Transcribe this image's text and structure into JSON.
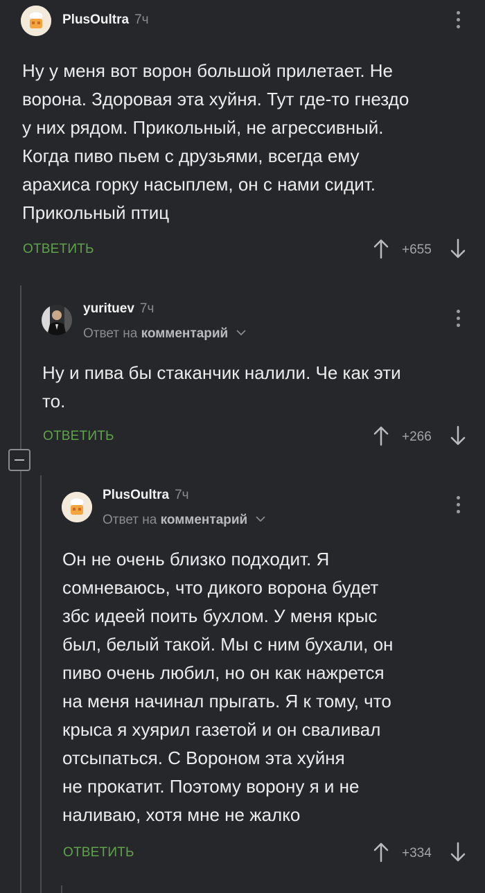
{
  "comments": [
    {
      "author": "PlusOultra",
      "time": "7ч",
      "text_lines": [
        "Ну у меня вот ворон большой прилетает. Не",
        "ворона. Здоровая эта хуйня. Тут где-то гнездо",
        "у них рядом. Прикольный, не агрессивный.",
        "Когда пиво пьем с друзьями, всегда ему",
        "арахиса горку насыплем, он с нами сидит.",
        "Прикольный птиц"
      ],
      "reply_label": "ОТВЕТИТЬ",
      "rating": "+655"
    },
    {
      "author": "yurituev",
      "time": "7ч",
      "reply_to_prefix": "Ответ на",
      "reply_to_target": "комментарий",
      "text_lines": [
        "Ну и пива бы стаканчик налили. Че как эти",
        "то."
      ],
      "reply_label": "ОТВЕТИТЬ",
      "rating": "+266"
    },
    {
      "author": "PlusOultra",
      "time": "7ч",
      "reply_to_prefix": "Ответ на",
      "reply_to_target": "комментарий",
      "text_lines": [
        "Он не очень близко подходит. Я",
        "сомневаюсь, что дикого ворона будет",
        "збс идеей поить бухлом. У меня крыс",
        "был, белый такой. Мы с ним бухали, он",
        "пиво очень любил, но он как нажрется",
        "на меня начинал прыгать. Я к тому, что",
        "крыса я хуярил газетой и он сваливал",
        "отсыпаться. С Вороном эта хуйня",
        "не прокатит. Поэтому ворону я и не",
        "наливаю, хотя мне не жалко"
      ],
      "reply_label": "ОТВЕТИТЬ",
      "rating": "+334"
    }
  ],
  "icons": {
    "upvote": "arrow-up-icon",
    "downvote": "arrow-down-icon",
    "menu": "kebab-menu-icon",
    "collapse": "collapse-thread-icon",
    "chevron": "chevron-down-icon"
  },
  "colors": {
    "background": "#25272a",
    "reply_green": "#5fa34a",
    "muted": "#8a8c8f"
  }
}
